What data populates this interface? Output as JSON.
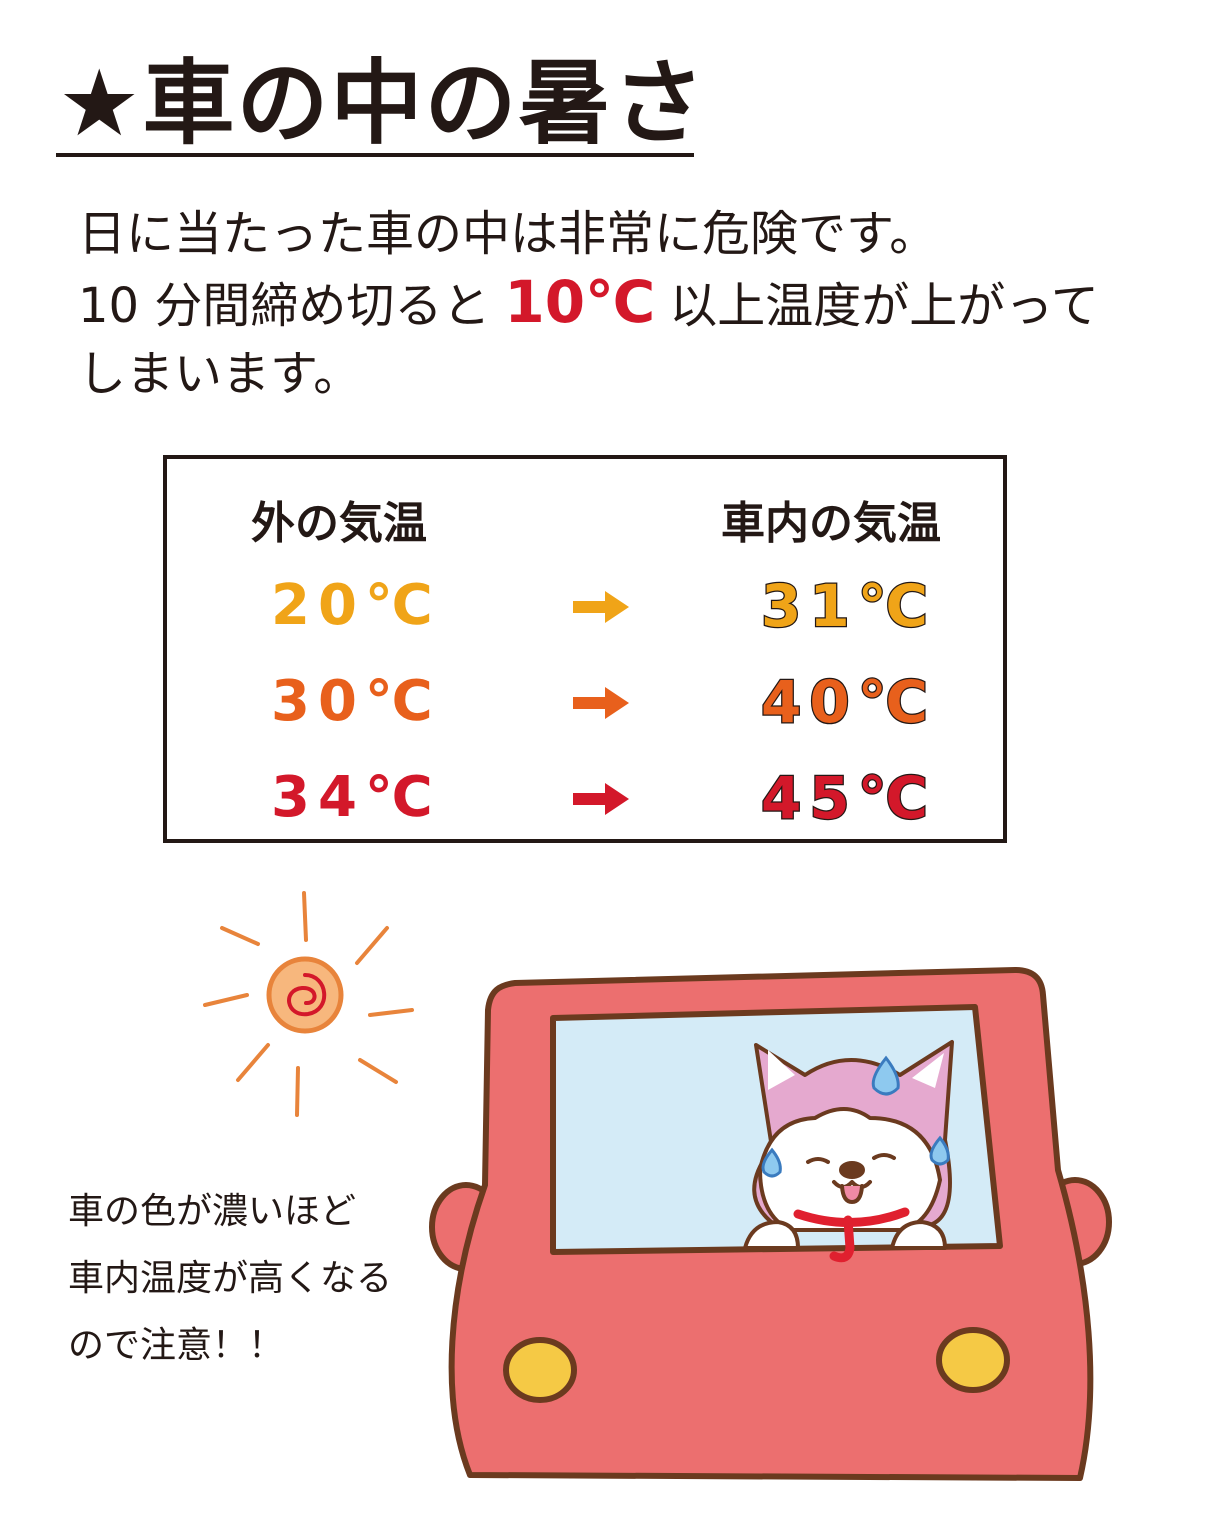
{
  "title": "★車の中の暑さ",
  "intro": {
    "line1": "日に当たった車の中は非常に危険です。",
    "line2_before": "10 分間締め切ると",
    "line2_highlight": "10℃",
    "line2_after": "以上温度が上がって",
    "line3": "しまいます。"
  },
  "table": {
    "header_outside": "外の気温",
    "header_inside": "車内の気温",
    "rows": [
      {
        "outside": "20℃",
        "inside": "31℃",
        "color": "#f0a418"
      },
      {
        "outside": "30℃",
        "inside": "40℃",
        "color": "#e8601c"
      },
      {
        "outside": "34℃",
        "inside": "45℃",
        "color": "#d3182a"
      }
    ]
  },
  "note": {
    "line1": "車の色が濃いほど",
    "line2": "車内温度が高くなる",
    "line3": "ので注意！！"
  },
  "colors": {
    "text": "#231815",
    "highlight_red": "#d3182a",
    "car_body": "#ec6f6f",
    "car_window": "#d4ebf7",
    "sun": "#e8843b"
  },
  "icons": [
    "sun-icon",
    "car-icon",
    "dog-icon",
    "arrow-right-icon",
    "sweat-drop-icon"
  ]
}
